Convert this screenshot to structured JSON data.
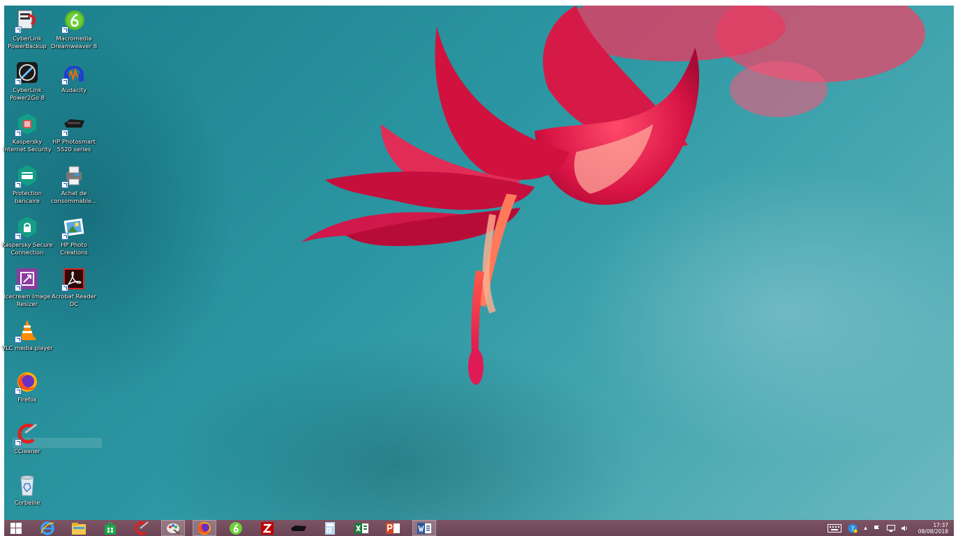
{
  "desktop": {
    "icons": [
      {
        "name": "cyberlink-powerbackup",
        "label_line1": "CyberLink",
        "label_line2": "PowerBackup"
      },
      {
        "name": "macromedia-dreamweaver",
        "label_line1": "Macromedia",
        "label_line2": "Dreamweaver 8"
      },
      {
        "name": "cyberlink-power2go",
        "label_line1": "CyberLink",
        "label_line2": "Power2Go 8"
      },
      {
        "name": "audacity",
        "label_line1": "Audacity",
        "label_line2": ""
      },
      {
        "name": "kaspersky-internet-security",
        "label_line1": "Kaspersky",
        "label_line2": "Internet Security"
      },
      {
        "name": "hp-photosmart",
        "label_line1": "HP Photosmart",
        "label_line2": "5520 series"
      },
      {
        "name": "protection-bancaire",
        "label_line1": "Protection",
        "label_line2": "bancaire"
      },
      {
        "name": "achat-consommables",
        "label_line1": "Achat de",
        "label_line2": "consommable..."
      },
      {
        "name": "kaspersky-secure-connection",
        "label_line1": "Kaspersky Secure",
        "label_line2": "Connection"
      },
      {
        "name": "hp-photo-creations",
        "label_line1": "HP Photo",
        "label_line2": "Creations"
      },
      {
        "name": "icecream-image-resizer",
        "label_line1": "Icecream Image",
        "label_line2": "Resizer"
      },
      {
        "name": "acrobat-reader",
        "label_line1": "Acrobat Reader",
        "label_line2": "DC"
      },
      {
        "name": "vlc-media-player",
        "label_line1": "VLC media player",
        "label_line2": ""
      },
      {
        "name": "firefox",
        "label_line1": "Firefox",
        "label_line2": ""
      },
      {
        "name": "ccleaner",
        "label_line1": "CCleaner",
        "label_line2": ""
      },
      {
        "name": "corbeille",
        "label_line1": "Corbeille",
        "label_line2": ""
      }
    ]
  },
  "taskbar": {
    "apps": [
      "start-icon",
      "internet-explorer-icon",
      "file-explorer-icon",
      "store-icon",
      "ccleaner-icon",
      "paint-icon",
      "firefox-icon",
      "dreamweaver-icon",
      "filezilla-icon",
      "hp-printer-icon",
      "calculator-icon",
      "excel-icon",
      "powerpoint-icon",
      "word-icon"
    ],
    "active_app": "word-icon"
  },
  "tray": {
    "time": "17:37",
    "date": "08/08/2018"
  },
  "colors": {
    "taskbar": "#6a4556",
    "wallpaper": "#2c98a3",
    "flower": "#e0234e"
  }
}
